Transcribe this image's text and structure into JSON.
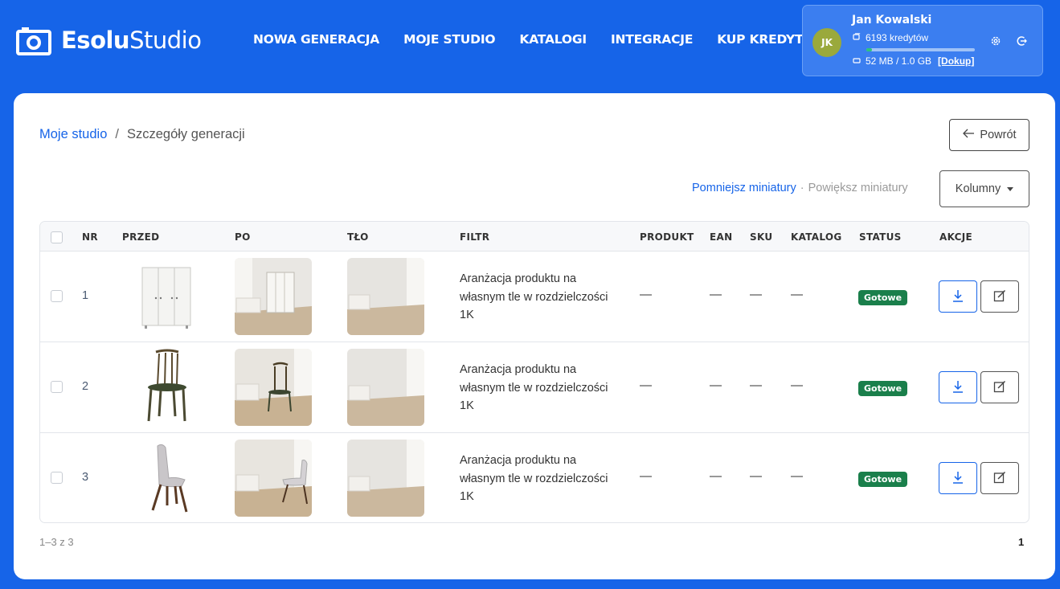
{
  "brand": {
    "name_bold": "Esolu",
    "name_light": "Studio"
  },
  "nav": [
    "NOWA GENERACJA",
    "MOJE STUDIO",
    "KATALOGI",
    "INTEGRACJE",
    "KUP KREDYTY"
  ],
  "user": {
    "initials": "JK",
    "name": "Jan Kowalski",
    "credits": "6193 kredytów",
    "storage": "52 MB / 1.0 GB",
    "topup": "[Dokup]",
    "storage_used_fraction": 0.05
  },
  "breadcrumb": {
    "parent": "Moje studio",
    "separator": "/",
    "current": "Szczegóły generacji"
  },
  "back_label": "Powrót",
  "thumbs": {
    "smaller": "Pomniejsz miniatury",
    "separator": "·",
    "larger": "Powiększ miniatury"
  },
  "columns_label": "Kolumny",
  "table": {
    "headers": [
      "NR",
      "PRZED",
      "PO",
      "TŁO",
      "FILTR",
      "PRODUKT",
      "EAN",
      "SKU",
      "KATALOG",
      "STATUS",
      "AKCJE"
    ],
    "rows": [
      {
        "nr": "1",
        "filter": "Aranżacja produktu na własnym tle w rozdzielczości 1K",
        "produkt": "—",
        "ean": "—",
        "sku": "—",
        "katalog": "—",
        "status": "Gotowe"
      },
      {
        "nr": "2",
        "filter": "Aranżacja produktu na własnym tle w rozdzielczości 1K",
        "produkt": "—",
        "ean": "—",
        "sku": "—",
        "katalog": "—",
        "status": "Gotowe"
      },
      {
        "nr": "3",
        "filter": "Aranżacja produktu na własnym tle w rozdzielczości 1K",
        "produkt": "—",
        "ean": "—",
        "sku": "—",
        "katalog": "—",
        "status": "Gotowe"
      }
    ]
  },
  "footer": {
    "count": "1–3 z 3",
    "page": "1"
  },
  "colors": {
    "brand_blue": "#1664e8",
    "status_green": "#1a7f4b"
  }
}
